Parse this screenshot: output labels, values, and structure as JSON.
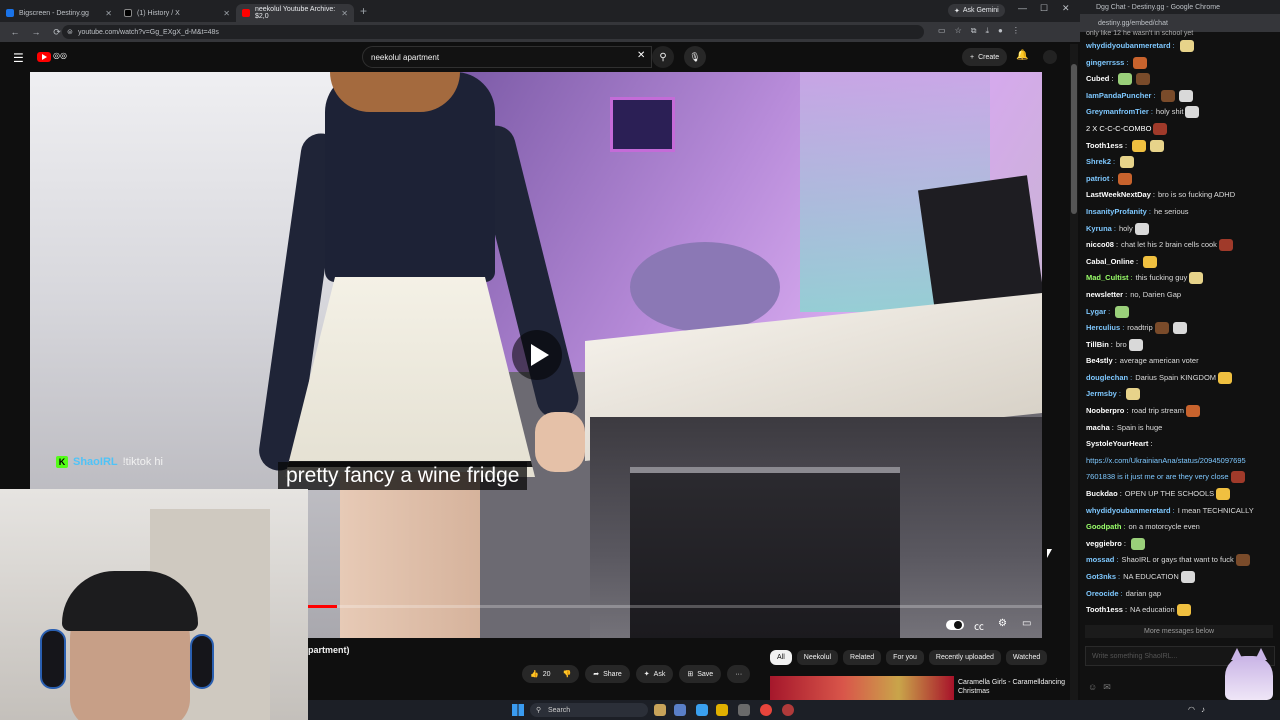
{
  "browser": {
    "tabs": [
      {
        "title": "Bigscreen - Destiny.gg",
        "color": "#1a73e8"
      },
      {
        "title": "(1) History / X",
        "color": "#000000"
      },
      {
        "title": "neekolul Youtube Archive: $2,0",
        "color": "#ff0000"
      }
    ],
    "new_tab_label": "+",
    "ask_gemini": "Ask Gemini",
    "url": "youtube.com/watch?v=Gg_EXgX_d-M&t=48s"
  },
  "youtube": {
    "search_value": "neekolul apartment",
    "create_label": "Create",
    "caption": "pretty fancy a wine fridge",
    "progress_fraction": 0.04,
    "overlay": {
      "name": "ShaoIRL",
      "message": "!tiktok hi",
      "badge": "K"
    },
    "title": "partment)",
    "actions": {
      "likes": "20",
      "share": "Share",
      "ask": "Ask",
      "save": "Save",
      "more": "···"
    },
    "chips": [
      {
        "label": "All",
        "selected": true
      },
      {
        "label": "Neekolul",
        "selected": false
      },
      {
        "label": "Related",
        "selected": false
      },
      {
        "label": "For you",
        "selected": false
      },
      {
        "label": "Recently uploaded",
        "selected": false
      },
      {
        "label": "Watched",
        "selected": false
      }
    ],
    "recommendation": {
      "title": "Caramella Girls - Caramelldancing Christmas"
    }
  },
  "chat": {
    "window_title": "Dgg Chat - Destiny.gg - Google Chrome",
    "url": "destiny.gg/embed/chat",
    "top_text": "only like 12 he wasn't in school yet",
    "lines": [
      {
        "user": "whydidyoubanmeretard",
        "color": "#7ec8ff",
        "text": "",
        "emotes": 1
      },
      {
        "user": "gingerrsss",
        "color": "#7ec8ff",
        "text": "",
        "emotes": 1
      },
      {
        "user": "Cubed",
        "color": "#ffffff",
        "text": "",
        "emotes": 2
      },
      {
        "user": "IamPandaPuncher",
        "color": "#7ec8ff",
        "text": "",
        "emotes": 2
      },
      {
        "user": "GreymanfromTier",
        "color": "#7ec8ff",
        "text": "holy shit",
        "emotes": 1
      },
      {
        "user": "",
        "color": "#ffffff",
        "text": "2 X C-C-C-COMBO",
        "emotes": 1
      },
      {
        "user": "Tooth1ess",
        "color": "#ffffff",
        "text": "",
        "emotes": 2
      },
      {
        "user": "Shrek2",
        "color": "#7ec8ff",
        "text": "",
        "emotes": 1
      },
      {
        "user": "patriot",
        "color": "#7ec8ff",
        "text": "",
        "emotes": 1
      },
      {
        "user": "LastWeekNextDay",
        "color": "#ffffff",
        "text": "bro is so fucking ADHD",
        "emotes": 0
      },
      {
        "user": "InsanityProfanity",
        "color": "#7ec8ff",
        "text": "he serious",
        "emotes": 0
      },
      {
        "user": "Kyruna",
        "color": "#7ec8ff",
        "text": "holy",
        "emotes": 1
      },
      {
        "user": "nicco08",
        "color": "#ffffff",
        "text": "chat let his 2 brain cells cook",
        "emotes": 1
      },
      {
        "user": "Cabal_Online",
        "color": "#ffffff",
        "text": "",
        "emotes": 1
      },
      {
        "user": "Mad_Cultist",
        "color": "#9aff6a",
        "text": "this fucking guy",
        "emotes": 1
      },
      {
        "user": "newsletter",
        "color": "#ffffff",
        "text": "no, Darien Gap",
        "emotes": 0
      },
      {
        "user": "Lygar",
        "color": "#7ec8ff",
        "text": "",
        "emotes": 1
      },
      {
        "user": "Herculius",
        "color": "#7ec8ff",
        "text": "roadtrip",
        "emotes": 2
      },
      {
        "user": "TillBin",
        "color": "#ffffff",
        "text": "bro",
        "emotes": 1
      },
      {
        "user": "Be4stly",
        "color": "#ffffff",
        "text": "average american voter",
        "emotes": 0
      },
      {
        "user": "douglechan",
        "color": "#7ec8ff",
        "text": "Darius Spain KINGDOM",
        "emotes": 1
      },
      {
        "user": "Jermsby",
        "color": "#7ec8ff",
        "text": "",
        "emotes": 1
      },
      {
        "user": "Nooberpro",
        "color": "#ffffff",
        "text": "road trip stream",
        "emotes": 1
      },
      {
        "user": "macha",
        "color": "#ffffff",
        "text": "Spain is huge",
        "emotes": 0
      },
      {
        "user": "SystoleYourHeart",
        "color": "#ffffff",
        "text": "",
        "emotes": 0
      },
      {
        "user": "",
        "color": "#7ec8ff",
        "text": "https://x.com/UkrainianAna/status/20945097695",
        "emotes": 0
      },
      {
        "user": "",
        "color": "#7ec8ff",
        "text": "7601838 is it just me or are they very close",
        "emotes": 1
      },
      {
        "user": "Buckdao",
        "color": "#ffffff",
        "text": "OPEN UP THE SCHOOLS",
        "emotes": 1
      },
      {
        "user": "whydidyoubanmeretard",
        "color": "#7ec8ff",
        "text": "I mean TECHNICALLY",
        "emotes": 0
      },
      {
        "user": "Goodpath",
        "color": "#9aff6a",
        "text": "on a motorcycle even",
        "emotes": 0
      },
      {
        "user": "veggiebro",
        "color": "#ffffff",
        "text": "",
        "emotes": 1
      },
      {
        "user": "mossad",
        "color": "#7ec8ff",
        "text": "ShaoIRL or gays that want to fuck",
        "emotes": 1
      },
      {
        "user": "Got3nks",
        "color": "#7ec8ff",
        "text": "NA EDUCATION",
        "emotes": 1
      },
      {
        "user": "Oreocide",
        "color": "#7ec8ff",
        "text": "darian gap",
        "emotes": 0
      },
      {
        "user": "Tooth1ess",
        "color": "#ffffff",
        "text": "NA education",
        "emotes": 1
      }
    ],
    "more_messages": "More messages below",
    "input_placeholder": "Write something ShaoIRL..."
  },
  "taskbar": {
    "search_placeholder": "Search"
  }
}
